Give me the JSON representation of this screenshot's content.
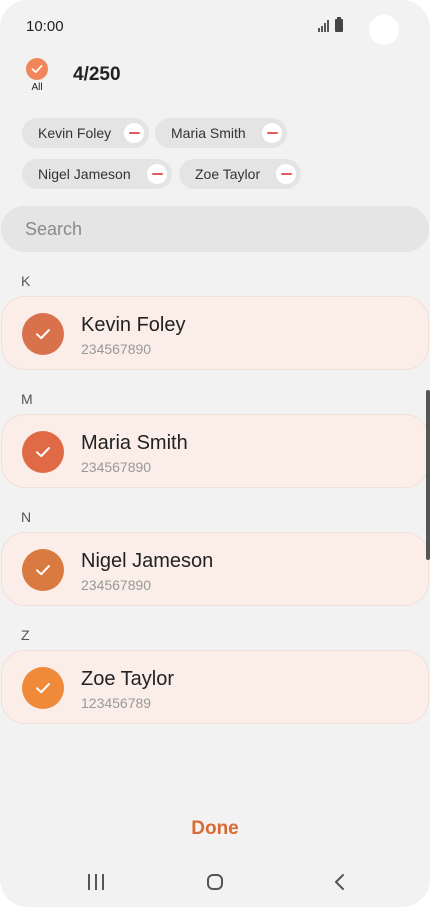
{
  "status_bar": {
    "time": "10:00"
  },
  "header": {
    "all_label": "All",
    "selected_count": "4/250"
  },
  "selected_chips": [
    {
      "label": "Kevin Foley"
    },
    {
      "label": "Maria Smith"
    },
    {
      "label": "Nigel Jameson"
    },
    {
      "label": "Zoe Taylor"
    }
  ],
  "search": {
    "placeholder": "Search"
  },
  "sections": [
    {
      "letter": "K",
      "contact": {
        "name": "Kevin Foley",
        "phone": "234567890",
        "checked": true,
        "color": "#d9714d"
      }
    },
    {
      "letter": "M",
      "contact": {
        "name": "Maria Smith",
        "phone": "234567890",
        "checked": true,
        "color": "#e06a45"
      }
    },
    {
      "letter": "N",
      "contact": {
        "name": "Nigel Jameson",
        "phone": "234567890",
        "checked": true,
        "color": "#d97a40"
      }
    },
    {
      "letter": "Z",
      "contact": {
        "name": "Zoe Taylor",
        "phone": "123456789",
        "checked": true,
        "color": "#ee8a3a"
      }
    }
  ],
  "footer": {
    "done_label": "Done"
  },
  "colors": {
    "accent": "#d96a33",
    "check_all": "#f0865a",
    "row_bg": "#fbeee8"
  }
}
